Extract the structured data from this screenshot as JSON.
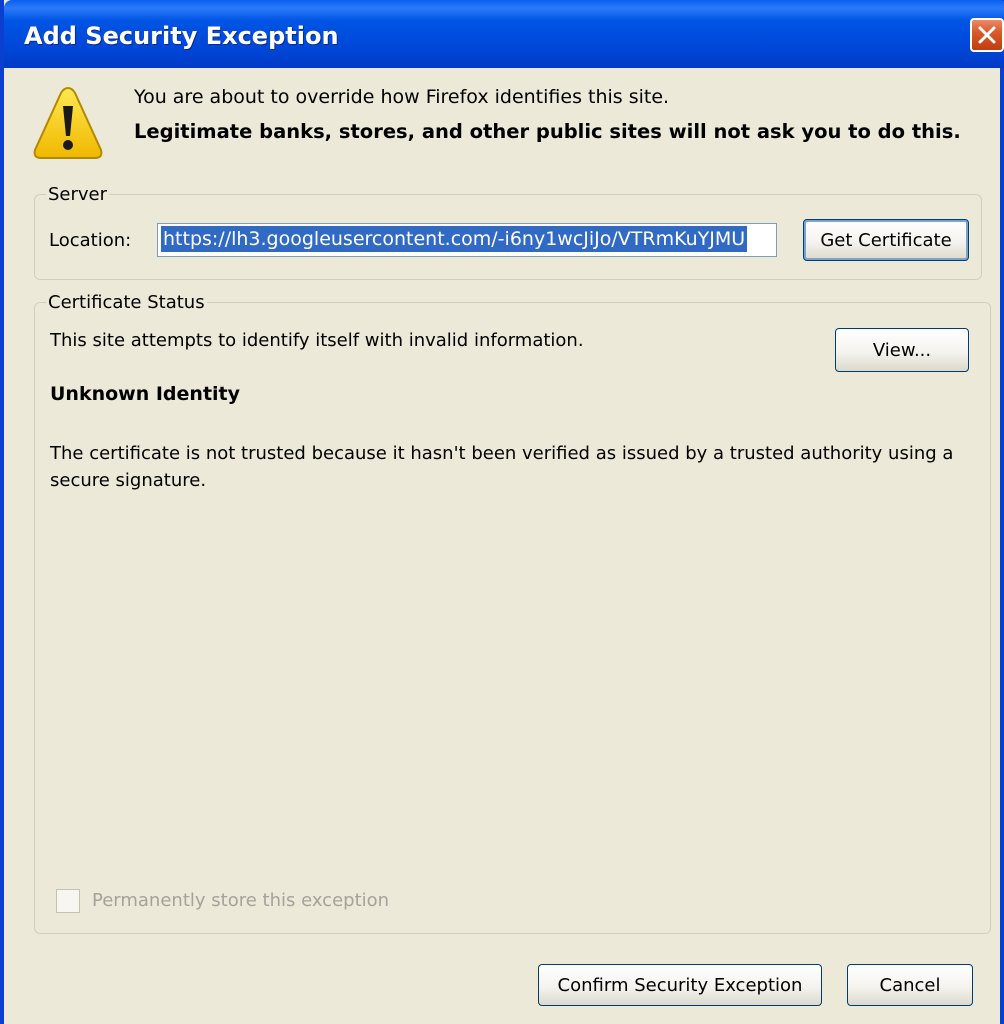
{
  "window": {
    "title": "Add Security Exception"
  },
  "icons": {
    "warning": "warning-triangle-icon",
    "close": "close-icon"
  },
  "colors": {
    "titlebar": "#0055e5",
    "dialog_bg": "#ece9d8",
    "selection": "#316ac5",
    "close_button": "#d95a2a",
    "warning_yellow": "#f5d000"
  },
  "intro": {
    "line1": "You are about to override how Firefox identifies this site.",
    "line2": "Legitimate banks, stores, and other public sites will not ask you to do this."
  },
  "server": {
    "legend": "Server",
    "location_label": "Location:",
    "location_value": "https://lh3.googleusercontent.com/-i6ny1wcJiJo/VTRmKuYJMU",
    "get_certificate_label": "Get Certificate"
  },
  "status": {
    "legend": "Certificate Status",
    "message": "This site attempts to identify itself with invalid information.",
    "view_label": "View...",
    "identity_title": "Unknown Identity",
    "description": "The certificate is not trusted because it hasn't been verified as issued by a trusted authority using a secure signature."
  },
  "permanent": {
    "label": "Permanently store this exception",
    "checked": false,
    "enabled": false
  },
  "buttons": {
    "confirm_label": "Confirm Security Exception",
    "cancel_label": "Cancel"
  }
}
